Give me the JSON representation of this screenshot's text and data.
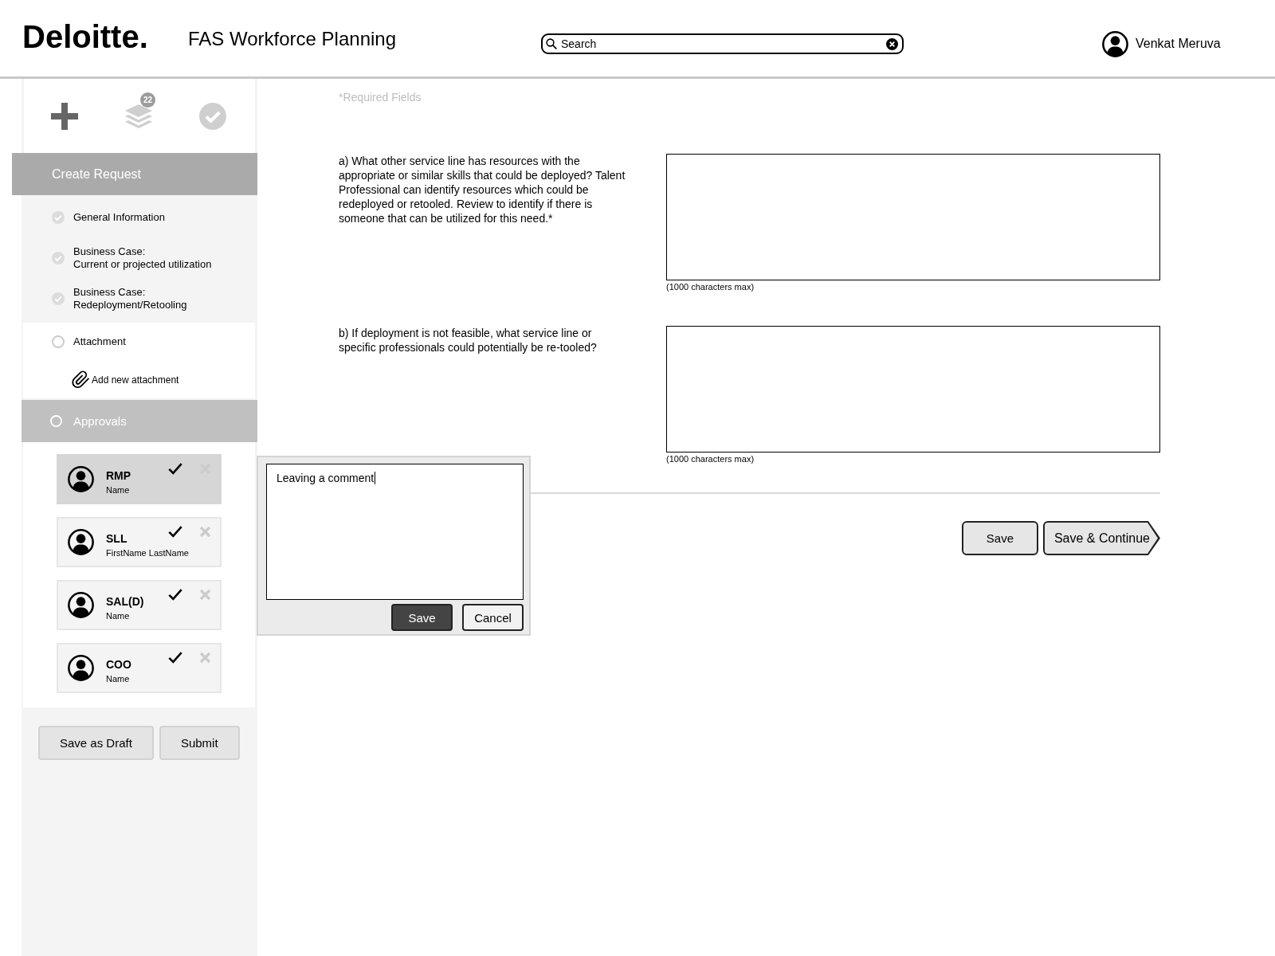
{
  "header": {
    "logo": "Deloitte.",
    "title": "FAS Workforce Planning",
    "search": {
      "placeholder": "Search"
    },
    "user": {
      "name": "Venkat Meruva"
    }
  },
  "sidebar": {
    "toolbar": [
      {
        "kind": "add",
        "selected": true
      },
      {
        "kind": "stack",
        "selected": false,
        "badge": "22"
      },
      {
        "kind": "check",
        "selected": false
      }
    ],
    "section_title": "Create Request",
    "steps": [
      {
        "label": "General Information",
        "completed": true
      },
      {
        "label": "Business Case:\nCurrent or projected utilization",
        "completed": true
      },
      {
        "label": "Business Case:\nRedeployment/Retooling",
        "completed": true
      },
      {
        "label": "Attachment",
        "completed": false,
        "action": "Add new attachment"
      }
    ],
    "approvals": {
      "label": "Approvals",
      "completed": false,
      "approvers": [
        {
          "role": "RMP",
          "name": "Name",
          "selected": true
        },
        {
          "role": "SLL",
          "name": "FirstName LastName",
          "selected": false
        },
        {
          "role": "SAL(D)",
          "name": "Name",
          "selected": false
        },
        {
          "role": "COO",
          "name": "Name",
          "selected": false
        }
      ]
    },
    "buttons": [
      "Save as Draft",
      "Submit"
    ]
  },
  "form": {
    "note": "*Required Fields",
    "questions": [
      {
        "text": "a) What other service line has resources with the appropriate or similar skills that could be deployed? Talent Professional can identify resources which could be redeployed or retooled. Review to identify if there is someone that can be utilized for this need.*",
        "hint": "(1000 characters max)"
      },
      {
        "text": "b) If deployment is not feasible, what service line or specific professionals could potentially be re-tooled?",
        "hint": "(1000 characters max)"
      }
    ],
    "buttons": [
      {
        "label": "Save",
        "kind": "plain"
      },
      {
        "label": "Save & Continue",
        "kind": "next"
      }
    ]
  },
  "comment_popup": {
    "value": "Leaving a comment",
    "focused": true,
    "buttons": [
      {
        "label": "Save",
        "kind": "primary"
      },
      {
        "label": "Cancel",
        "kind": "plain"
      }
    ]
  }
}
